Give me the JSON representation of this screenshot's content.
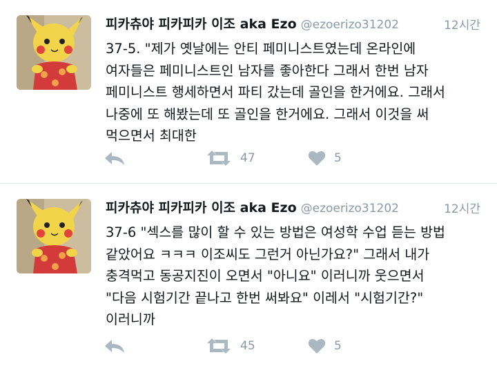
{
  "tweets": [
    {
      "display_name": "피카츄야 피카피카 이조 aka Ezo",
      "handle": "@ezoerizo31202",
      "time": "12시간",
      "text": "37-5. \"제가 옛날에는 안티 페미니스트였는데 온라인에\n여자들은 페미니스트인 남자를 좋아한다 그래서 한번 남자\n페미니스트 행세하면서 파티 갔는데 골인을 한거에요. 그래서\n나중에 또 해봤는데 또 골인을 한거에요. 그래서 이것을 써\n먹으면서 최대한",
      "retweets": "47",
      "likes": "5"
    },
    {
      "display_name": "피카츄야 피카피카 이조 aka Ezo",
      "handle": "@ezoerizo31202",
      "time": "12시간",
      "text": "37-6 \"섹스를 많이 할 수 있는 방법은 여성학 수업 듣는 방법\n같았어요 ㅋㅋㅋ 이조씨도 그런거 아닌가요?\" 그래서 내가\n충격먹고 동공지진이 오면서 \"아니요\" 이러니까 웃으면서\n\"다음 시험기간 끝나고 한번 써봐요\" 이레서 \"시험기간?\"\n이러니까",
      "retweets": "45",
      "likes": "5"
    }
  ],
  "icons": {
    "reply": "reply-arrow-icon",
    "retweet": "retweet-icon",
    "like": "heart-icon"
  },
  "colors": {
    "icon": "#aab8c2",
    "muted_text": "#8899a6",
    "divider": "#e1e8ed"
  }
}
